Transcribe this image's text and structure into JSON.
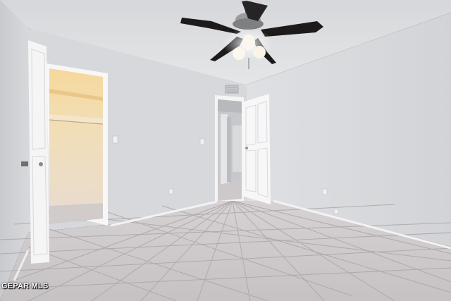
{
  "photo": {
    "watermark": "GEPAR MLS",
    "colors": {
      "ceiling": "#dedfe1",
      "left_wall": "#d3d4d7",
      "back_wall": "#d8d9dc",
      "right_wall": "#dcdde0",
      "floor_tile": "#cbc7c9",
      "grout": "#a9a4a6",
      "closet_shelf": "#f3d9a6",
      "door": "#f6f6f6",
      "fan_blade": "#1c1a1b",
      "light_glass": "#fbf7ee"
    }
  }
}
